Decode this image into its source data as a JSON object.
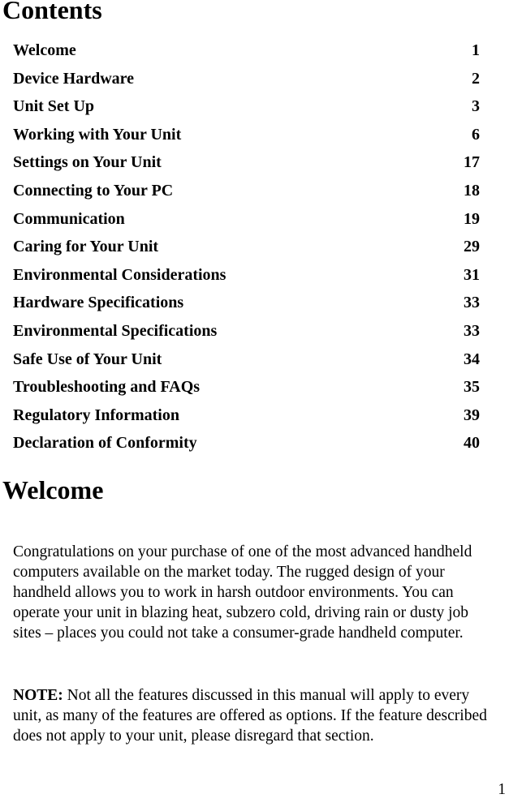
{
  "document": {
    "contents_heading": "Contents",
    "welcome_heading": "Welcome",
    "page_number": "1"
  },
  "toc": {
    "entries": [
      {
        "title": "Welcome",
        "page": "1"
      },
      {
        "title": "Device Hardware",
        "page": "2"
      },
      {
        "title": "Unit Set Up",
        "page": "3"
      },
      {
        "title": "Working with Your Unit",
        "page": "6"
      },
      {
        "title": "Settings on Your Unit",
        "page": "17"
      },
      {
        "title": "Connecting to Your PC",
        "page": "18"
      },
      {
        "title": "Communication",
        "page": "19"
      },
      {
        "title": "Caring for Your Unit",
        "page": "29"
      },
      {
        "title": "Environmental Considerations",
        "page": "31"
      },
      {
        "title": "Hardware Specifications",
        "page": "33"
      },
      {
        "title": "Environmental Specifications",
        "page": "33"
      },
      {
        "title": "Safe Use of Your Unit",
        "page": "34"
      },
      {
        "title": "Troubleshooting and FAQs",
        "page": "35"
      },
      {
        "title": "Regulatory Information",
        "page": "39"
      },
      {
        "title": "Declaration of Conformity",
        "page": "40"
      }
    ]
  },
  "welcome_section": {
    "paragraph": "Congratulations on your purchase of one of the most advanced handheld computers available on the market today. The rugged design of your handheld allows you to work in harsh outdoor environments. You can operate your unit in blazing heat, subzero cold, driving rain or dusty job sites – places you could not take a consumer-grade handheld computer.",
    "note_label": "NOTE:",
    "note_text": " Not all the features discussed in this manual will apply to every unit, as many of the features are offered as options. If the feature described does not apply to your unit, please disregard that section."
  }
}
